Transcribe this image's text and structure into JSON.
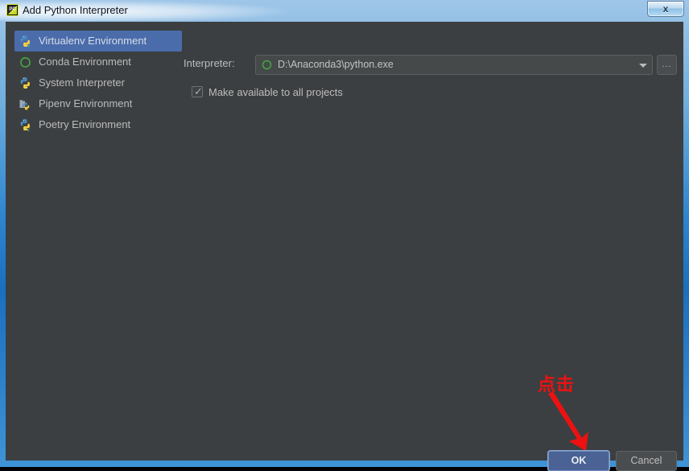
{
  "window": {
    "title": "Add Python Interpreter",
    "app_icon": "pycharm-icon",
    "close_label": "x"
  },
  "sidebar": {
    "items": [
      {
        "label": "Virtualenv Environment",
        "icon": "python-venv-icon",
        "selected": true
      },
      {
        "label": "Conda Environment",
        "icon": "conda-ring-icon",
        "selected": false
      },
      {
        "label": "System Interpreter",
        "icon": "python-icon",
        "selected": false
      },
      {
        "label": "Pipenv Environment",
        "icon": "pipenv-icon",
        "selected": false
      },
      {
        "label": "Poetry Environment",
        "icon": "poetry-python-icon",
        "selected": false
      }
    ]
  },
  "main": {
    "interpreter_label": "Interpreter:",
    "interpreter_value": "D:\\Anaconda3\\python.exe",
    "interpreter_icon": "conda-ring-icon",
    "dropdown_icon": "chevron-down-icon",
    "browse_label": "...",
    "make_available_label": "Make available to all projects",
    "make_available_checked": true
  },
  "footer": {
    "ok_label": "OK",
    "cancel_label": "Cancel"
  },
  "annotation": {
    "text": "点击",
    "color": "#ee1111",
    "arrow": "down-right-arrow-icon"
  },
  "colors": {
    "panel_bg": "#3c3f41",
    "selection_blue": "#4a6cab",
    "ok_blue": "#4a6394",
    "annotation_red": "#ee1111",
    "title_gradient_top": "#9fc6e8"
  }
}
